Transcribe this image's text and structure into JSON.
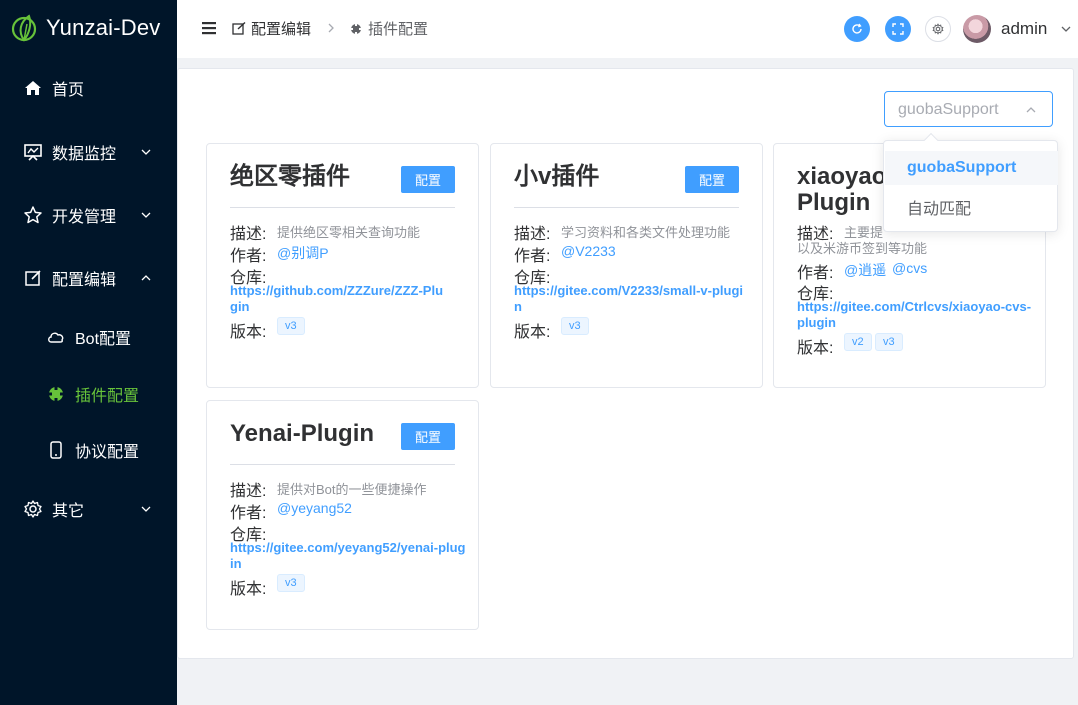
{
  "app": {
    "title": "Yunzai-Dev"
  },
  "sidebar": {
    "items": [
      {
        "label": "首页",
        "icon": "home-icon"
      },
      {
        "label": "数据监控",
        "icon": "monitor-icon"
      },
      {
        "label": "开发管理",
        "icon": "star-icon"
      },
      {
        "label": "配置编辑",
        "icon": "edit-icon"
      },
      {
        "label": "Bot配置",
        "icon": "cloud-icon"
      },
      {
        "label": "插件配置",
        "icon": "plugin-icon"
      },
      {
        "label": "协议配置",
        "icon": "phone-icon"
      },
      {
        "label": "其它",
        "icon": "gear-icon"
      }
    ]
  },
  "header": {
    "breadcrumb": [
      "配置编辑",
      "插件配置"
    ],
    "user": "admin"
  },
  "filter": {
    "value": "guobaSupport",
    "options": [
      "guobaSupport",
      "自动匹配"
    ]
  },
  "labels": {
    "desc": "描述:",
    "author": "作者:",
    "repo": "仓库:",
    "version": "版本:",
    "config": "配置"
  },
  "plugins": [
    {
      "name": "绝区零插件",
      "desc": "提供绝区零相关查询功能",
      "authors": [
        "@别调P"
      ],
      "repo": "https://github.com/ZZZure/ZZZ-Plugin",
      "versions": [
        "v3"
      ]
    },
    {
      "name": "小v插件",
      "desc": "学习资料和各类文件处理功能",
      "authors": [
        "@V2233"
      ],
      "repo": "https://gitee.com/V2233/small-v-plugin",
      "versions": [
        "v3"
      ]
    },
    {
      "name_line1": "xiaoyao",
      "name_line2": "Plugin",
      "desc_line1": "主要提",
      "desc_line2": "以及米游币签到等功能",
      "authors": [
        "@逍遥",
        "@cvs"
      ],
      "repo": "https://gitee.com/Ctrlcvs/xiaoyao-cvs-plugin",
      "versions": [
        "v2",
        "v3"
      ]
    },
    {
      "name": "Yenai-Plugin",
      "desc": "提供对Bot的一些便捷操作",
      "authors": [
        "@yeyang52"
      ],
      "repo": "https://gitee.com/yeyang52/yenai-plugin",
      "versions": [
        "v3"
      ]
    }
  ],
  "colors": {
    "sidebar_bg": "#001529",
    "accent": "#409eff",
    "active_green": "#67c23a"
  }
}
